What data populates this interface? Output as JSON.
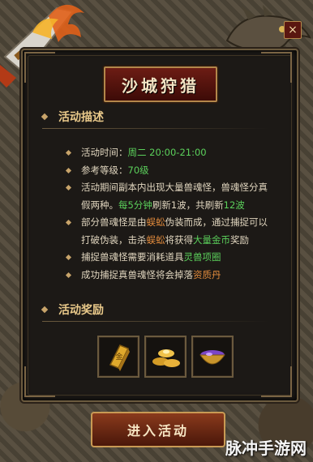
{
  "window": {
    "title": "沙城狩猎",
    "close_label": "×"
  },
  "sections": {
    "description_heading": "活动描述",
    "reward_heading": "活动奖励"
  },
  "description": {
    "item1_label": "活动时间：",
    "item1_value": "周二 20:00-21:00",
    "item2_label": "参考等级：",
    "item2_value": "70级",
    "item3_a": "活动期间副本内出现大量兽魂怪，兽魂怪分真假两种。",
    "item3_b": "每5分钟",
    "item3_c": "刷新1波，共刷新",
    "item3_d": "12波",
    "item4_a": "部分兽魂怪是由",
    "item4_b": "蜈蚣",
    "item4_c": "伪装而成，通过捕捉可以打破伪装，击杀",
    "item4_d": "蜈蚣",
    "item4_e": "将获得",
    "item4_f": "大量金币",
    "item4_g": "奖励",
    "item5_a": "捕捉兽魂怪需要消耗道具",
    "item5_b": "灵兽项圈",
    "item6_a": "成功捕捉真兽魂怪将会掉落",
    "item6_b": "资质丹"
  },
  "rewards": {
    "item_icons": [
      "gold-bar-icon",
      "gold-ingots-icon",
      "treasure-bowl-icon"
    ],
    "gold_bar_glyph": "金"
  },
  "enter_button": {
    "label": "进入活动"
  },
  "watermark": "脉冲手游网"
}
